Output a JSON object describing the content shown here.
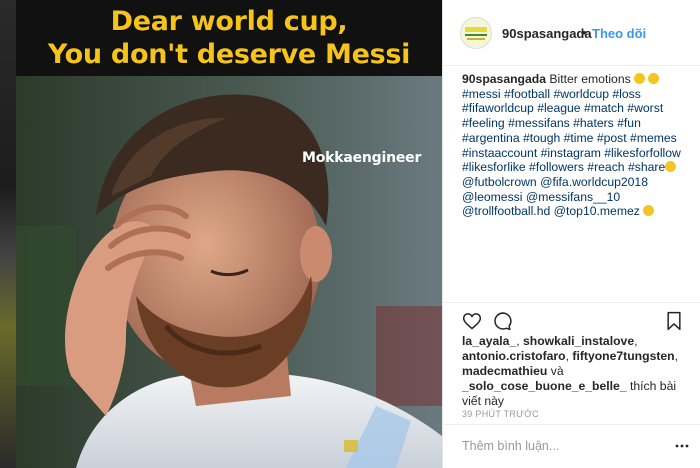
{
  "post_image": {
    "banner_line1": "Dear world cup,",
    "banner_line2": "You don't deserve Messi",
    "watermark": "Mokkaengineer"
  },
  "header": {
    "username": "90spasangada",
    "separator": "•",
    "follow_label": "Theo dõi"
  },
  "caption": {
    "username": "90spasangada",
    "text": "Bitter emotions",
    "hashtags": "#messi #football #worldcup #loss #fifaworldcup #league #match #worst #feeling #messifans #haters #fun #argentina #tough #time #post #memes #instaaccount #instagram #likesforfollow #likesforlike #followers #reach #share",
    "mentions1": "@futbolcrown @fifa.worldcup2018",
    "mentions2": "@leomessi @messifans__10",
    "mentions3": "@trollfootball.hd @top10.memez"
  },
  "actions": {
    "icons": [
      "heart-icon",
      "comment-icon",
      "bookmark-icon"
    ]
  },
  "likes": {
    "user1": "la_ayala_",
    "sep1": ", ",
    "user2": "showkali_instalove",
    "sep2": ",",
    "user3": "antonio.cristofaro",
    "sep3": ", ",
    "user4": "fiftyone7tungsten",
    "sep4": ",",
    "user5": "madecmathieu",
    "sep5": " và",
    "user6": "_solo_cose_buone_e_belle_",
    "suffix": " thích bài viết này"
  },
  "timestamp": "39 phút trước",
  "comment": {
    "placeholder": "Thêm bình luận..."
  },
  "colors": {
    "link": "#3897f0",
    "hashtag": "#003569",
    "banner_text": "#f6c418"
  }
}
